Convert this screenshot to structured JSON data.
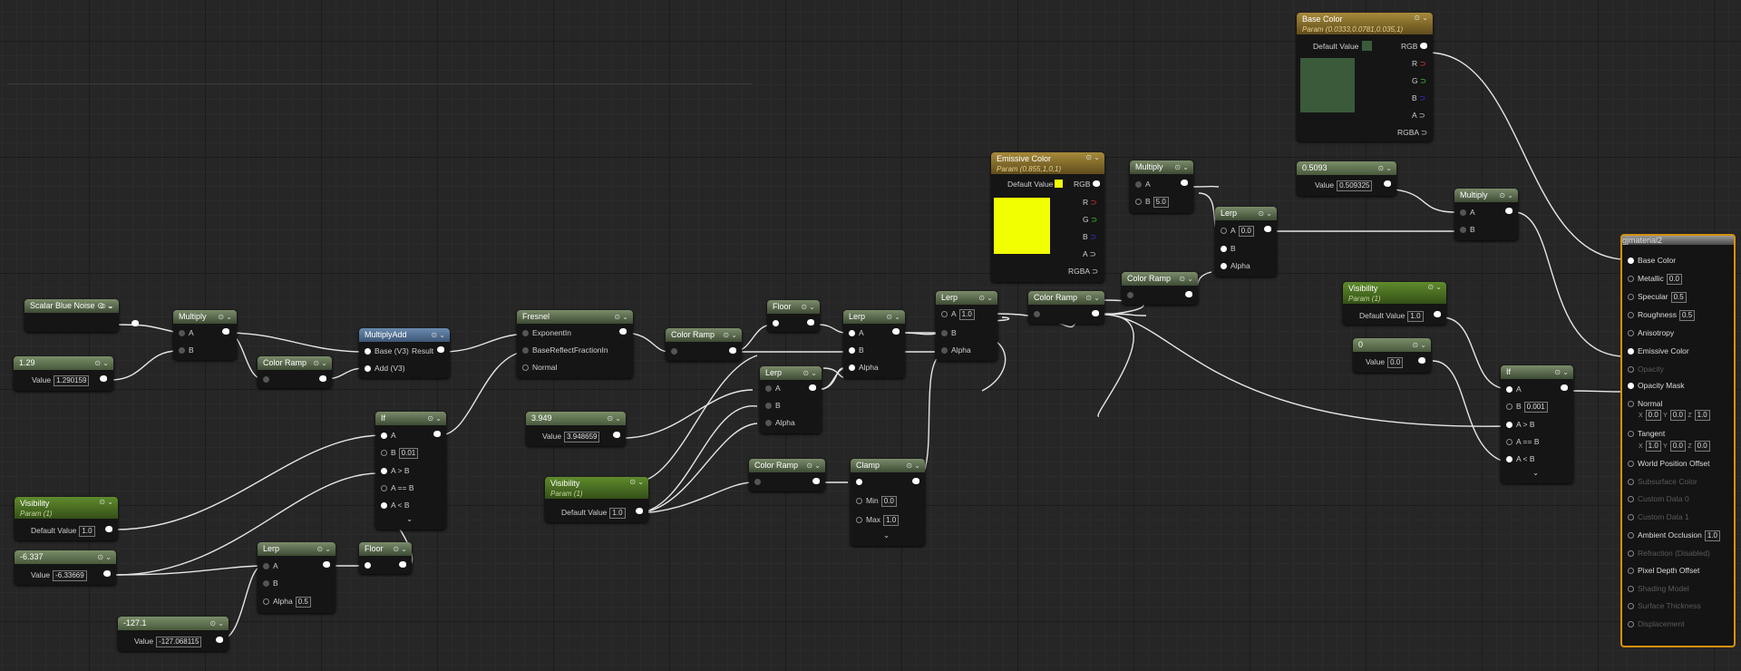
{
  "nodes": {
    "scalar_blue_noise": {
      "title": "Scalar Blue Noise"
    },
    "multiply_1": {
      "title": "Multiply",
      "a": "A",
      "b": "B"
    },
    "const_129": {
      "title": "1.29",
      "value_label": "Value",
      "value": "1.290159"
    },
    "color_ramp_1": {
      "title": "Color Ramp"
    },
    "multiply_add": {
      "title": "MultiplyAdd",
      "base": "Base (V3)",
      "result": "Result",
      "add": "Add (V3)"
    },
    "fresnel": {
      "title": "Fresnel",
      "p1": "ExponentIn",
      "p2": "BaseReflectFractionIn",
      "p3": "Normal"
    },
    "color_ramp_2": {
      "title": "Color Ramp"
    },
    "floor_1": {
      "title": "Floor"
    },
    "lerp_1": {
      "title": "Lerp",
      "a": "A",
      "b": "B",
      "alpha": "Alpha"
    },
    "lerp_2": {
      "title": "Lerp",
      "a": "A",
      "b": "B",
      "alpha": "Alpha"
    },
    "lerp_3": {
      "title": "Lerp",
      "a": "A",
      "a_val": "1.0",
      "b": "B",
      "alpha": "Alpha"
    },
    "color_ramp_3": {
      "title": "Color Ramp"
    },
    "emissive": {
      "title": "Emissive Color",
      "subtitle": "Param (0.855,1,0,1)",
      "default": "Default Value",
      "rgb": "RGB",
      "r": "R",
      "g": "G",
      "b": "B",
      "a": "A",
      "rgba": "RGBA",
      "color": "#f2ff00"
    },
    "multiply_2": {
      "title": "Multiply",
      "a": "A",
      "b": "B",
      "b_val": "5.0"
    },
    "color_ramp_4": {
      "title": "Color Ramp"
    },
    "lerp_4": {
      "title": "Lerp",
      "a": "A",
      "a_val": "0.0",
      "b": "B",
      "alpha": "Alpha"
    },
    "base_color": {
      "title": "Base Color",
      "subtitle": "Param (0.0333,0.0781,0.035,1)",
      "default": "Default Value",
      "rgb": "RGB",
      "r": "R",
      "g": "G",
      "b": "B",
      "a": "A",
      "rgba": "RGBA",
      "color": "#3a5a3a"
    },
    "const_05093": {
      "title": "0.5093",
      "value_label": "Value",
      "value": "0.509325"
    },
    "multiply_3": {
      "title": "Multiply",
      "a": "A",
      "b": "B"
    },
    "visibility_1": {
      "title": "Visibility",
      "subtitle": "Param (1)",
      "default": "Default Value",
      "value": "1.0"
    },
    "const_0": {
      "title": "0",
      "value_label": "Value",
      "value": "0.0"
    },
    "if_2": {
      "title": "If",
      "a": "A",
      "b": "B",
      "b_val": "0.001",
      "agb": "A > B",
      "aeb": "A == B",
      "alb": "A < B"
    },
    "if_1": {
      "title": "If",
      "a": "A",
      "b": "B",
      "b_val": "0.01",
      "agb": "A > B",
      "aeb": "A == B",
      "alb": "A < B"
    },
    "const_3949": {
      "title": "3.949",
      "value_label": "Value",
      "value": "3.948659"
    },
    "visibility_2": {
      "title": "Visibility",
      "subtitle": "Param (1)",
      "default": "Default Value",
      "value": "1.0"
    },
    "color_ramp_5": {
      "title": "Color Ramp"
    },
    "clamp": {
      "title": "Clamp",
      "min": "Min",
      "min_val": "0.0",
      "max": "Max",
      "max_val": "1.0"
    },
    "visibility_3": {
      "title": "Visibility",
      "subtitle": "Param (1)",
      "default": "Default Value",
      "value": "1.0"
    },
    "const_neg6": {
      "title": "-6.337",
      "value_label": "Value",
      "value": "-6.33669"
    },
    "lerp_5": {
      "title": "Lerp",
      "a": "A",
      "b": "B",
      "alpha": "Alpha",
      "alpha_val": "0.5"
    },
    "floor_2": {
      "title": "Floor"
    },
    "const_neg127": {
      "title": "-127.1",
      "value_label": "Value",
      "value": "-127.068115"
    }
  },
  "material": {
    "title": "gjmaterial2",
    "base_color": "Base Color",
    "metallic": "Metallic",
    "metallic_val": "0.0",
    "specular": "Specular",
    "specular_val": "0.5",
    "roughness": "Roughness",
    "roughness_val": "0.5",
    "anisotropy": "Anisotropy",
    "emissive": "Emissive Color",
    "opacity": "Opacity",
    "opacity_mask": "Opacity Mask",
    "normal": "Normal",
    "tangent": "Tangent",
    "nx": "0.0",
    "ny": "0.0",
    "nz": "1.0",
    "tx": "1.0",
    "ty": "0.0",
    "tz": "0.0",
    "wpo": "World Position Offset",
    "subsurface": "Subsurface Color",
    "custom0": "Custom Data 0",
    "custom1": "Custom Data 1",
    "ao": "Ambient Occlusion",
    "ao_val": "1.0",
    "refraction": "Refraction (Disabled)",
    "pdo": "Pixel Depth Offset",
    "shading": "Shading Model",
    "thickness": "Surface Thickness",
    "displacement": "Displacement"
  }
}
